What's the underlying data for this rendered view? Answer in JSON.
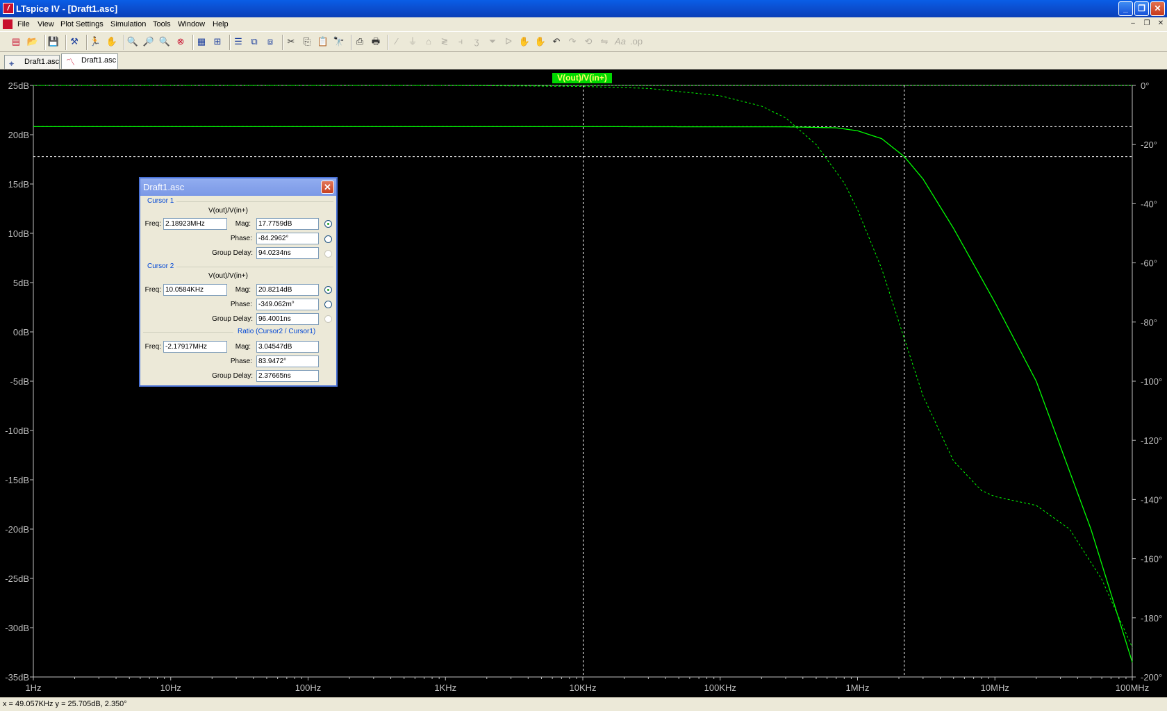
{
  "window": {
    "title": "LTspice IV - [Draft1.asc]"
  },
  "menu": [
    "File",
    "View",
    "Plot Settings",
    "Simulation",
    "Tools",
    "Window",
    "Help"
  ],
  "tabs": [
    {
      "label": "Draft1.asc",
      "icon": "schematic-icon"
    },
    {
      "label": "Draft1.asc",
      "icon": "waveform-icon"
    }
  ],
  "chart_data": {
    "type": "line",
    "trace_label": "V(out)/V(in+)",
    "x_scale": "log",
    "x_ticks": [
      "1Hz",
      "10Hz",
      "100Hz",
      "1KHz",
      "10KHz",
      "100KHz",
      "1MHz",
      "10MHz",
      "100MHz"
    ],
    "xlim_hz": [
      1,
      100000000
    ],
    "y_left_ticks": [
      "25dB",
      "20dB",
      "15dB",
      "10dB",
      "5dB",
      "0dB",
      "-5dB",
      "-10dB",
      "-15dB",
      "-20dB",
      "-25dB",
      "-30dB",
      "-35dB"
    ],
    "ylim_db": [
      -35,
      25
    ],
    "y_right_ticks": [
      "0°",
      "-20°",
      "-40°",
      "-60°",
      "-80°",
      "-100°",
      "-120°",
      "-140°",
      "-160°",
      "-180°",
      "-200°"
    ],
    "ylim_deg": [
      -200,
      0
    ],
    "colors": {
      "background": "#000000",
      "trace": "#00ff00",
      "axis": "#bfbfbf",
      "cursor": "#ffffff"
    },
    "series": [
      {
        "name": "magnitude (dB)",
        "style": "solid",
        "x": [
          1,
          10,
          100,
          1000,
          10000,
          100000,
          300000,
          700000,
          1000000,
          1500000,
          2189230,
          3000000,
          5000000,
          10000000,
          20000000,
          50000000,
          100000000
        ],
        "y": [
          20.82,
          20.82,
          20.82,
          20.82,
          20.82,
          20.8,
          20.8,
          20.7,
          20.4,
          19.6,
          17.78,
          15.5,
          10.5,
          3,
          -5,
          -20,
          -33.5
        ]
      },
      {
        "name": "phase (deg)",
        "style": "dashed",
        "x": [
          1,
          10,
          100,
          1000,
          10000,
          30000,
          100000,
          200000,
          300000,
          500000,
          800000,
          1000000,
          1500000,
          2000000,
          3000000,
          5000000,
          8000000,
          10000000,
          20000000,
          35000000,
          60000000,
          100000000
        ],
        "y": [
          0,
          0,
          0,
          0,
          -0.35,
          -1.0,
          -3.5,
          -7,
          -11,
          -20,
          -33,
          -42,
          -62,
          -80,
          -105,
          -127,
          -137,
          -139,
          -142,
          -150,
          -167,
          -190
        ]
      }
    ],
    "cursors": [
      {
        "name": "Cursor 2",
        "freq_hz": 10058.4,
        "mag_db": 20.8214
      },
      {
        "name": "Cursor 1",
        "freq_hz": 2189230,
        "mag_db": 17.7759
      }
    ]
  },
  "dialog": {
    "title": "Draft1.asc",
    "cursor1": {
      "group": "Cursor 1",
      "trace": "V(out)/V(in+)",
      "freq_label": "Freq:",
      "freq": "2.18923MHz",
      "mag_label": "Mag:",
      "mag": "17.7759dB",
      "phase_label": "Phase:",
      "phase": "-84.2962°",
      "gd_label": "Group Delay:",
      "gd": "94.0234ns"
    },
    "cursor2": {
      "group": "Cursor 2",
      "trace": "V(out)/V(in+)",
      "freq_label": "Freq:",
      "freq": "10.0584KHz",
      "mag_label": "Mag:",
      "mag": "20.8214dB",
      "phase_label": "Phase:",
      "phase": "-349.062m°",
      "gd_label": "Group Delay:",
      "gd": "96.4001ns"
    },
    "ratio": {
      "group": "Ratio (Cursor2 / Cursor1)",
      "freq_label": "Freq:",
      "freq": "-2.17917MHz",
      "mag_label": "Mag:",
      "mag": "3.04547dB",
      "phase_label": "Phase:",
      "phase": "83.9472°",
      "gd_label": "Group Delay:",
      "gd": "2.37665ns"
    }
  },
  "status": {
    "text": "x = 49.057KHz   y = 25.705dB, 2.350°"
  }
}
